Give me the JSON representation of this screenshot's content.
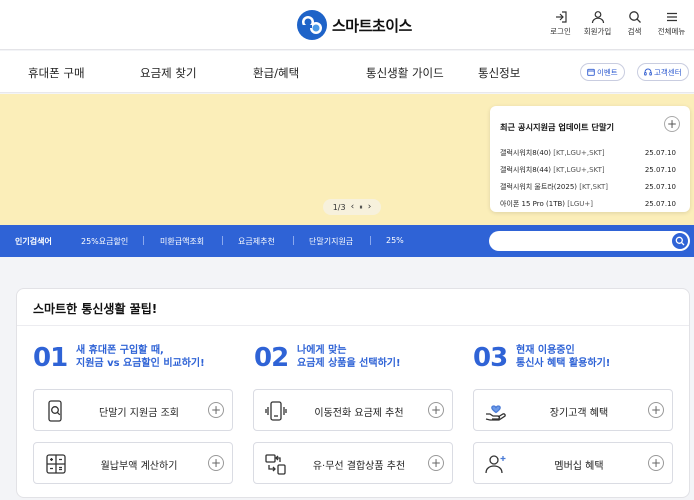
{
  "header": {
    "logo_text": "스마트초이스",
    "icons": [
      {
        "name": "login-icon",
        "label": "로그인"
      },
      {
        "name": "user-icon",
        "label": "회원가입"
      },
      {
        "name": "search-icon",
        "label": "검색"
      },
      {
        "name": "menu-icon",
        "label": "전체메뉴"
      }
    ]
  },
  "nav": {
    "items": [
      "휴대폰 구매",
      "요금제 찾기",
      "환급/혜택",
      "통신생활 가이드",
      "통신정보"
    ],
    "event_label": "이벤트",
    "support_label": "고객센터"
  },
  "banner": {
    "bg_color": "#fbeeb9",
    "pager": {
      "text": "1/3",
      "prev": "‹",
      "pause": "⏸",
      "next": "›"
    },
    "card": {
      "title": "최근 공시지원금 업데이트 단말기",
      "rows": [
        {
          "name": "갤럭시워치8(40)",
          "carriers": "[KT,LGU+,SKT]",
          "date": "25.07.10"
        },
        {
          "name": "갤럭시워치8(44)",
          "carriers": "[KT,LGU+,SKT]",
          "date": "25.07.10"
        },
        {
          "name": "갤럭시워치 울트라(2025)",
          "carriers": "[KT,SKT]",
          "date": "25.07.10"
        },
        {
          "name": "아이폰 15 Pro (1TB)",
          "carriers": "[LGU+]",
          "date": "25.07.10"
        }
      ]
    }
  },
  "popular": {
    "label": "인기검색어",
    "items": [
      "25%요금할인",
      "미환급액조회",
      "요금제추천",
      "단말기지원금",
      "25%"
    ],
    "search_placeholder": "",
    "accent": "#2f63d6"
  },
  "tips": {
    "title": "스마트한 통신생활 꿀팁!",
    "steps": [
      {
        "num": "01",
        "line1": "새 휴대폰 구입할 때,",
        "line2": "지원금 vs 요금할인 비교하기!"
      },
      {
        "num": "02",
        "line1": "나에게 맞는",
        "line2": "요금제 상품을 선택하기!"
      },
      {
        "num": "03",
        "line1": "현재 이용중인",
        "line2": "통신사 혜택 활용하기!"
      }
    ],
    "tiles": [
      {
        "icon": "phone-search-icon",
        "label": "단말기 지원금 조회"
      },
      {
        "icon": "phone-plan-icon",
        "label": "이동전화 요금제 추천"
      },
      {
        "icon": "hand-heart-icon",
        "label": "장기고객 혜택"
      },
      {
        "icon": "calculator-icon",
        "label": "월납부액 계산하기"
      },
      {
        "icon": "bundle-icon",
        "label": "유·무선 결합상품 추천"
      },
      {
        "icon": "user-plus-icon",
        "label": "멤버십 혜택"
      }
    ]
  }
}
